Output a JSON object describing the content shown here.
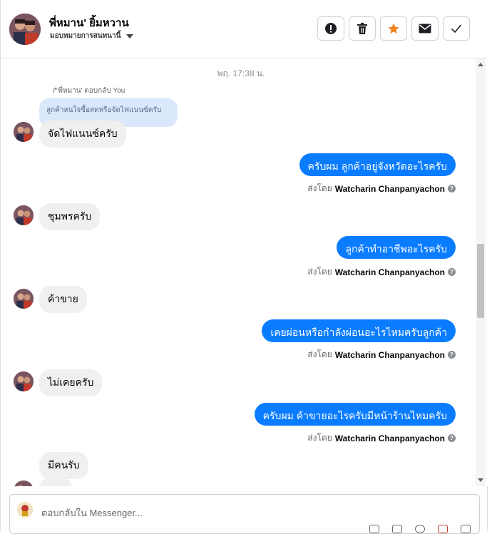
{
  "header": {
    "name": "พี่หมาน' ยิ้มหวาน",
    "assign_label": "มอบหมายการสนทนานี้"
  },
  "actions": [
    {
      "name": "spam-alert-button",
      "icon": "alert-circle-icon"
    },
    {
      "name": "delete-button",
      "icon": "trash-icon"
    },
    {
      "name": "star-button",
      "icon": "star-icon"
    },
    {
      "name": "mark-unread-button",
      "icon": "envelope-icon"
    },
    {
      "name": "mark-done-button",
      "icon": "check-icon"
    }
  ],
  "conversation": {
    "timestamp": "พฤ. 17:38 น.",
    "reply_label": "พี่หมาน' ตอบกลับ You",
    "quoted_text": "ลูกค้าสนใจซื้อสดหรือจัดไฟแนนซ์ครับ",
    "sent_by_prefix": "ส่งโดย",
    "sent_by_name": "Watcharin Chanpanyachon",
    "messages": [
      {
        "dir": "in",
        "text": "จัดไฟแนนซ์ครับ"
      },
      {
        "dir": "out",
        "text": "ครับผม ลูกค้าอยู่จังหวัดอะไรครับ"
      },
      {
        "dir": "in",
        "text": "ชุมพรครับ"
      },
      {
        "dir": "out",
        "text": "ลูกค้าทำอาชีพอะไรครับ"
      },
      {
        "dir": "in",
        "text": "ค้าขาย"
      },
      {
        "dir": "out",
        "text": "เคยผ่อนหรือกำลังผ่อนอะไรไหมครับลูกค้า"
      },
      {
        "dir": "in",
        "text": "ไม่เคยครับ"
      },
      {
        "dir": "out",
        "text": "ครับผม ค้าขายอะไรครับมีหน้าร้านไหมครับ"
      },
      {
        "dir": "in",
        "text": "มีคนรับ"
      }
    ]
  },
  "composer": {
    "placeholder": "ตอบกลับใน Messenger..."
  },
  "colors": {
    "outgoing_bubble": "#0a7cff",
    "incoming_bubble": "#f0f0f0",
    "quote_bubble": "#dbe8fb",
    "star_accent": "#f5821f"
  }
}
